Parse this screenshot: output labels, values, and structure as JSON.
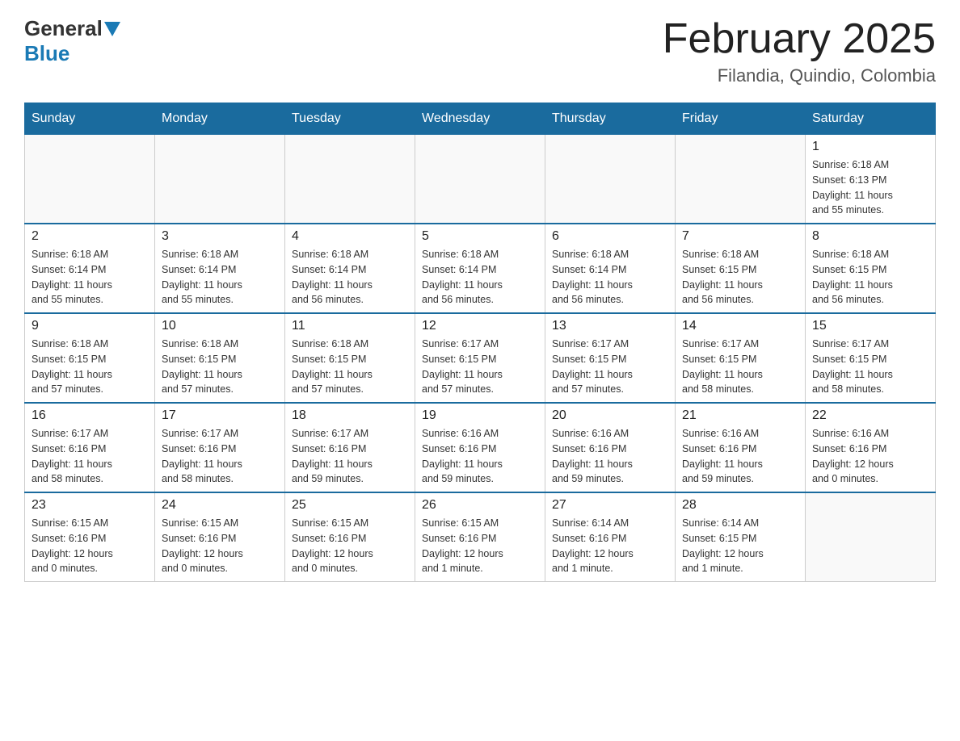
{
  "logo": {
    "general": "General",
    "blue": "Blue"
  },
  "title": "February 2025",
  "subtitle": "Filandia, Quindio, Colombia",
  "days_of_week": [
    "Sunday",
    "Monday",
    "Tuesday",
    "Wednesday",
    "Thursday",
    "Friday",
    "Saturday"
  ],
  "weeks": [
    [
      {
        "day": "",
        "info": ""
      },
      {
        "day": "",
        "info": ""
      },
      {
        "day": "",
        "info": ""
      },
      {
        "day": "",
        "info": ""
      },
      {
        "day": "",
        "info": ""
      },
      {
        "day": "",
        "info": ""
      },
      {
        "day": "1",
        "info": "Sunrise: 6:18 AM\nSunset: 6:13 PM\nDaylight: 11 hours\nand 55 minutes."
      }
    ],
    [
      {
        "day": "2",
        "info": "Sunrise: 6:18 AM\nSunset: 6:14 PM\nDaylight: 11 hours\nand 55 minutes."
      },
      {
        "day": "3",
        "info": "Sunrise: 6:18 AM\nSunset: 6:14 PM\nDaylight: 11 hours\nand 55 minutes."
      },
      {
        "day": "4",
        "info": "Sunrise: 6:18 AM\nSunset: 6:14 PM\nDaylight: 11 hours\nand 56 minutes."
      },
      {
        "day": "5",
        "info": "Sunrise: 6:18 AM\nSunset: 6:14 PM\nDaylight: 11 hours\nand 56 minutes."
      },
      {
        "day": "6",
        "info": "Sunrise: 6:18 AM\nSunset: 6:14 PM\nDaylight: 11 hours\nand 56 minutes."
      },
      {
        "day": "7",
        "info": "Sunrise: 6:18 AM\nSunset: 6:15 PM\nDaylight: 11 hours\nand 56 minutes."
      },
      {
        "day": "8",
        "info": "Sunrise: 6:18 AM\nSunset: 6:15 PM\nDaylight: 11 hours\nand 56 minutes."
      }
    ],
    [
      {
        "day": "9",
        "info": "Sunrise: 6:18 AM\nSunset: 6:15 PM\nDaylight: 11 hours\nand 57 minutes."
      },
      {
        "day": "10",
        "info": "Sunrise: 6:18 AM\nSunset: 6:15 PM\nDaylight: 11 hours\nand 57 minutes."
      },
      {
        "day": "11",
        "info": "Sunrise: 6:18 AM\nSunset: 6:15 PM\nDaylight: 11 hours\nand 57 minutes."
      },
      {
        "day": "12",
        "info": "Sunrise: 6:17 AM\nSunset: 6:15 PM\nDaylight: 11 hours\nand 57 minutes."
      },
      {
        "day": "13",
        "info": "Sunrise: 6:17 AM\nSunset: 6:15 PM\nDaylight: 11 hours\nand 57 minutes."
      },
      {
        "day": "14",
        "info": "Sunrise: 6:17 AM\nSunset: 6:15 PM\nDaylight: 11 hours\nand 58 minutes."
      },
      {
        "day": "15",
        "info": "Sunrise: 6:17 AM\nSunset: 6:15 PM\nDaylight: 11 hours\nand 58 minutes."
      }
    ],
    [
      {
        "day": "16",
        "info": "Sunrise: 6:17 AM\nSunset: 6:16 PM\nDaylight: 11 hours\nand 58 minutes."
      },
      {
        "day": "17",
        "info": "Sunrise: 6:17 AM\nSunset: 6:16 PM\nDaylight: 11 hours\nand 58 minutes."
      },
      {
        "day": "18",
        "info": "Sunrise: 6:17 AM\nSunset: 6:16 PM\nDaylight: 11 hours\nand 59 minutes."
      },
      {
        "day": "19",
        "info": "Sunrise: 6:16 AM\nSunset: 6:16 PM\nDaylight: 11 hours\nand 59 minutes."
      },
      {
        "day": "20",
        "info": "Sunrise: 6:16 AM\nSunset: 6:16 PM\nDaylight: 11 hours\nand 59 minutes."
      },
      {
        "day": "21",
        "info": "Sunrise: 6:16 AM\nSunset: 6:16 PM\nDaylight: 11 hours\nand 59 minutes."
      },
      {
        "day": "22",
        "info": "Sunrise: 6:16 AM\nSunset: 6:16 PM\nDaylight: 12 hours\nand 0 minutes."
      }
    ],
    [
      {
        "day": "23",
        "info": "Sunrise: 6:15 AM\nSunset: 6:16 PM\nDaylight: 12 hours\nand 0 minutes."
      },
      {
        "day": "24",
        "info": "Sunrise: 6:15 AM\nSunset: 6:16 PM\nDaylight: 12 hours\nand 0 minutes."
      },
      {
        "day": "25",
        "info": "Sunrise: 6:15 AM\nSunset: 6:16 PM\nDaylight: 12 hours\nand 0 minutes."
      },
      {
        "day": "26",
        "info": "Sunrise: 6:15 AM\nSunset: 6:16 PM\nDaylight: 12 hours\nand 1 minute."
      },
      {
        "day": "27",
        "info": "Sunrise: 6:14 AM\nSunset: 6:16 PM\nDaylight: 12 hours\nand 1 minute."
      },
      {
        "day": "28",
        "info": "Sunrise: 6:14 AM\nSunset: 6:15 PM\nDaylight: 12 hours\nand 1 minute."
      },
      {
        "day": "",
        "info": ""
      }
    ]
  ]
}
